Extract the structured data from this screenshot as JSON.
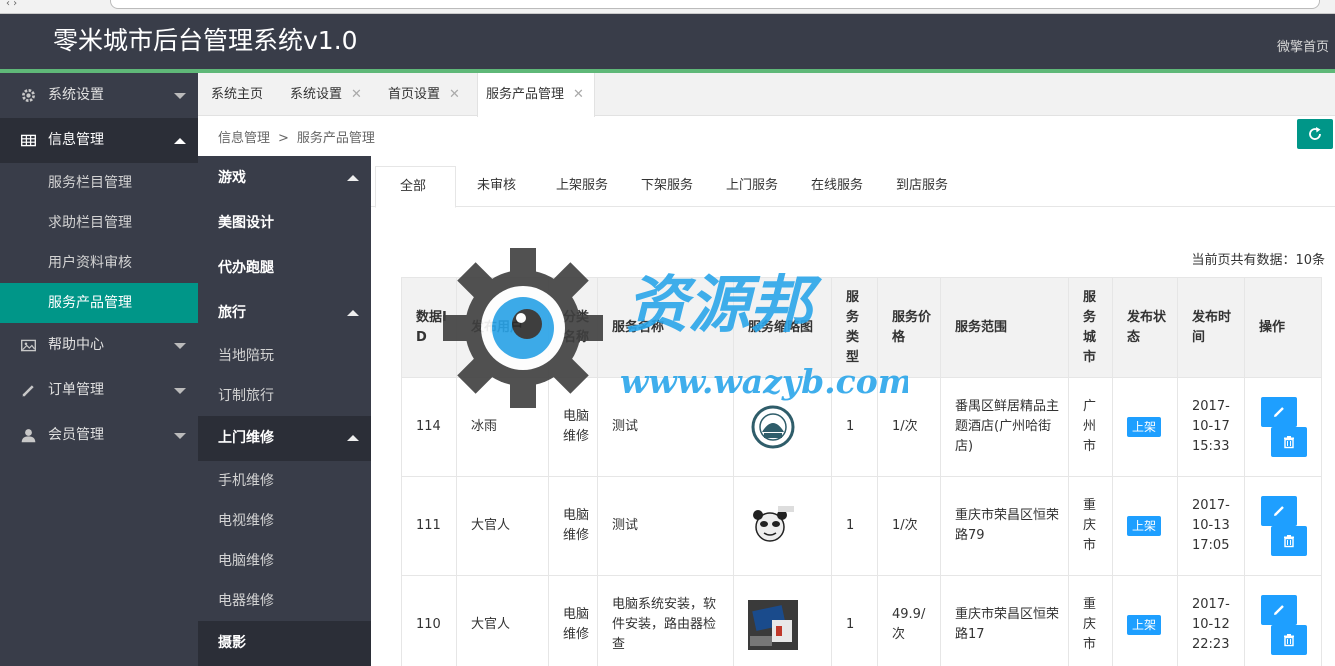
{
  "app": {
    "title": "零米城市后台管理系统v1.0",
    "home_link": "微擎首页",
    "accent_green": "#5fb878",
    "accent_teal": "#009688",
    "badge_blue": "#1e9fff",
    "sidebar_bg": "#393d49"
  },
  "sidebar": {
    "groups": [
      {
        "label": "系统设置",
        "icon": "gear-icon",
        "expanded": false
      },
      {
        "label": "信息管理",
        "icon": "grid-icon",
        "expanded": true,
        "items": [
          "服务栏目管理",
          "求助栏目管理",
          "用户资料审核",
          "服务产品管理"
        ],
        "selected": "服务产品管理"
      },
      {
        "label": "帮助中心",
        "icon": "image-icon",
        "expanded": false
      },
      {
        "label": "订单管理",
        "icon": "pencil-icon",
        "expanded": false
      },
      {
        "label": "会员管理",
        "icon": "user-icon",
        "expanded": false
      }
    ]
  },
  "tabs": [
    {
      "label": "系统主页",
      "closable": false
    },
    {
      "label": "系统设置",
      "closable": true
    },
    {
      "label": "首页设置",
      "closable": true
    },
    {
      "label": "服务产品管理",
      "closable": true,
      "active": true
    }
  ],
  "breadcrumb": {
    "items": [
      "信息管理",
      "服务产品管理"
    ],
    "separator": ">"
  },
  "categories": {
    "sections": [
      {
        "label": "游戏",
        "expanded": true,
        "items": []
      },
      {
        "label": "美图设计",
        "items": []
      },
      {
        "label": "代办跑腿",
        "items": []
      },
      {
        "label": "旅行",
        "expanded": true,
        "items": [
          "当地陪玩",
          "订制旅行"
        ]
      },
      {
        "label": "上门维修",
        "expanded": true,
        "items": [
          "手机维修",
          "电视维修",
          "电脑维修",
          "电器维修"
        ]
      },
      {
        "label": "摄影",
        "items": []
      }
    ]
  },
  "filter_tabs": [
    "全部",
    "未审核",
    "上架服务",
    "下架服务",
    "上门服务",
    "在线服务",
    "到店服务"
  ],
  "filter_active": "全部",
  "record_count_text": "当前页共有数据：10条",
  "table": {
    "headers": [
      "数据ID",
      "发布用户",
      "分类名称",
      "服务名称",
      "服务缩略图",
      "服务类型",
      "服务价格",
      "服务范围",
      "服务城市",
      "发布状态",
      "发布时间",
      "操作"
    ],
    "rows": [
      {
        "id": "114",
        "user": "冰雨",
        "category": "电脑维修",
        "name": "测试",
        "thumb": "logo-seal",
        "type": "1",
        "price": "1/次",
        "range": "番禺区鲜居精品主题酒店(广州哈街店)",
        "city": "广州市",
        "status": "上架",
        "time": "2017-10-17 15:33"
      },
      {
        "id": "111",
        "user": "大官人",
        "category": "电脑维修",
        "name": "测试",
        "thumb": "panda-meme",
        "type": "1",
        "price": "1/次",
        "range": "重庆市荣昌区恒荣路79",
        "city": "重庆市",
        "status": "上架",
        "time": "2017-10-13 17:05"
      },
      {
        "id": "110",
        "user": "大官人",
        "category": "电脑维修",
        "name": "电脑系统安装，软件安装，路由器检查",
        "thumb": "computer-photo",
        "type": "1",
        "price": "49.9/次",
        "range": "重庆市荣昌区恒荣路17",
        "city": "重庆市",
        "status": "上架",
        "time": "2017-10-12 22:23"
      }
    ]
  },
  "watermark": {
    "text": "资源邦",
    "url": "www.wazyb.com"
  }
}
